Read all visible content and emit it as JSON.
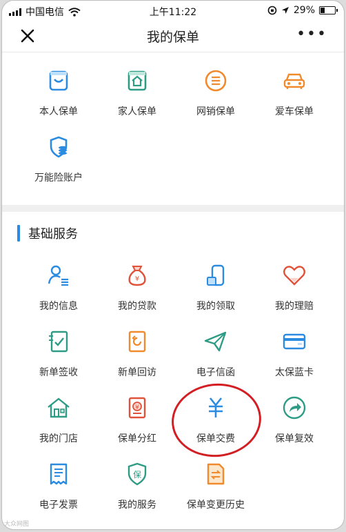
{
  "status_bar": {
    "carrier": "中国电信",
    "time": "上午11:22",
    "battery": "29%"
  },
  "navbar": {
    "title": "我的保单"
  },
  "policies": [
    {
      "label": "本人保单",
      "icon": "shopping-bag-icon"
    },
    {
      "label": "家人保单",
      "icon": "house-icon"
    },
    {
      "label": "网销保单",
      "icon": "list-circle-icon"
    },
    {
      "label": "爱车保单",
      "icon": "car-icon"
    },
    {
      "label": "万能险账户",
      "icon": "shield-coins-icon"
    }
  ],
  "section_title": "基础服务",
  "services": [
    {
      "label": "我的信息",
      "icon": "person-icon"
    },
    {
      "label": "我的贷款",
      "icon": "money-bag-icon"
    },
    {
      "label": "我的领取",
      "icon": "withdraw-icon"
    },
    {
      "label": "我的理赔",
      "icon": "heart-icon"
    },
    {
      "label": "新单签收",
      "icon": "sign-document-icon"
    },
    {
      "label": "新单回访",
      "icon": "return-visit-icon"
    },
    {
      "label": "电子信函",
      "icon": "paper-plane-icon"
    },
    {
      "label": "太保蓝卡",
      "icon": "card-icon"
    },
    {
      "label": "我的门店",
      "icon": "store-icon"
    },
    {
      "label": "保单分红",
      "icon": "dividend-icon"
    },
    {
      "label": "保单交费",
      "icon": "yuan-icon"
    },
    {
      "label": "保单复效",
      "icon": "share-circle-icon"
    },
    {
      "label": "电子发票",
      "icon": "invoice-icon"
    },
    {
      "label": "我的服务",
      "icon": "shield-bao-icon"
    },
    {
      "label": "保单变更历史",
      "icon": "change-history-icon"
    }
  ],
  "watermark": "大众网图",
  "colors": {
    "blue": "#2b8be0",
    "green": "#2e9b84",
    "orange": "#f08a2c",
    "red": "#e0523a",
    "highlight": "#d21f24"
  }
}
